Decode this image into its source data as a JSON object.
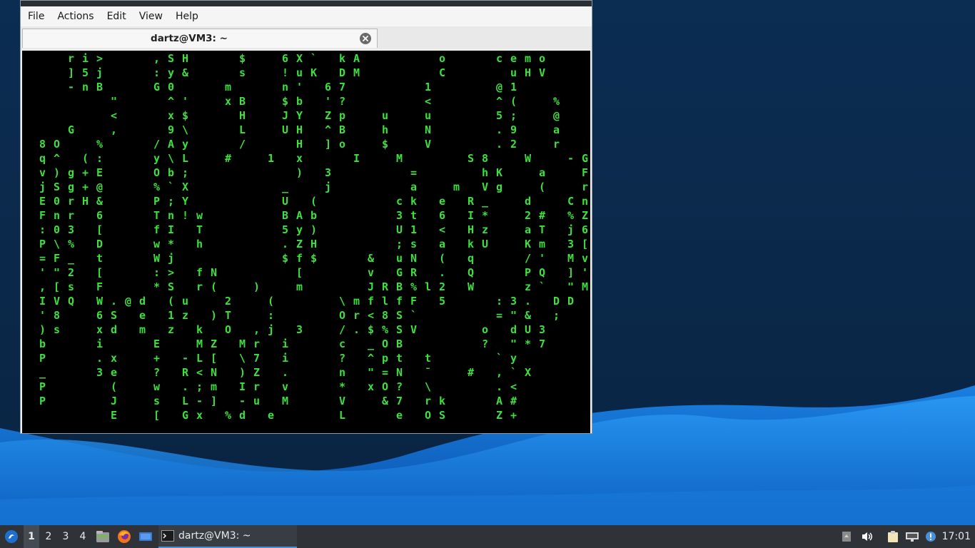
{
  "window": {
    "menu": [
      "File",
      "Actions",
      "Edit",
      "View",
      "Help"
    ],
    "tab_title": "dartz@VM3: ~"
  },
  "terminal": {
    "colors": {
      "green": "#3ee03e",
      "white": "#ffffff",
      "background": "#000000"
    },
    "matrix_rows": [
      "  ri>   ,SH   $  6X` kA     o   cemo   k6$ ",
      "  ]5j   :y&   s  !uK DM     C    uHV     e ",
      "  -nB   G0   m   n' 67     1    @1      * ",
      "     \"   ^'  xB  $b '?     <    ^(  %   9 ",
      "     <   x$   H  JY Zp  u  u    5;  @   , ",
      "  G  ,   9\\   L  UH ^B  h  N    .9  a   8 ",
      "8O  %   /Ay   /   H ]o  $  V    .2  r   > ",
      "q^ (:   y\\L  #  1 x   I  M    S8  W  -G ",
      "v)g+E   Ob;       ) 3     =    hK  a  FR ",
      "jSg+@   %`X      _  j     a  m Vg  (  rW ",
      "E0rH&   P;Y      U (     ck e R_  d  Cn ",
      "Fnr 6   Tn!w     BAb     3t 6 I*  2# %Z ",
      ":03 [   fI T     5y)     U1 < Hz  aT j6 ",
      "P\\% D   w* h     .ZH     ;s a kU  Km 3[ ",
      "=F_ t   Wj       $f$   & uN ( q   /' Mv ",
      "'\"2 [   :> fN     [    v GR . Q   PQ ]' ",
      ",[s F   *S r(  )  m    JRB%l2 W   z` \"M ",
      "IVQ W.@d (u  2  (    \\mflfF 5   :3. DD ",
      "'8  6S e 1z )T  :    Or<8S`     =\"& ; ",
      ")s  xd m z k O ,j 3  /.$%SV    o dU3 ",
      "b   i   E  MZ Mr i   c _OB     ? \"*7 ",
      "P   .x  + -L[ \\7 i   ? ^pt t    `y  ",
      "_   3e  ? R<N )Z .   n \"=N ¯  # ,`X ",
      "P    (  w .;m Ir v   * xO? \\    .<  ",
      "P    J  s L-] -u M   V  &7 rk   A#  ",
      "     E  [ Gx %d e    L   e OS   Z+  "
    ]
  },
  "taskbar": {
    "workspaces": [
      "1",
      "2",
      "3",
      "4"
    ],
    "active_task": "dartz@VM3: ~",
    "clock": "17:01"
  },
  "desktop": {
    "bg_colors": {
      "dark": "#0a2a4d",
      "wave_light": "#1e90f0",
      "wave_mid": "#0f6fd0"
    }
  }
}
